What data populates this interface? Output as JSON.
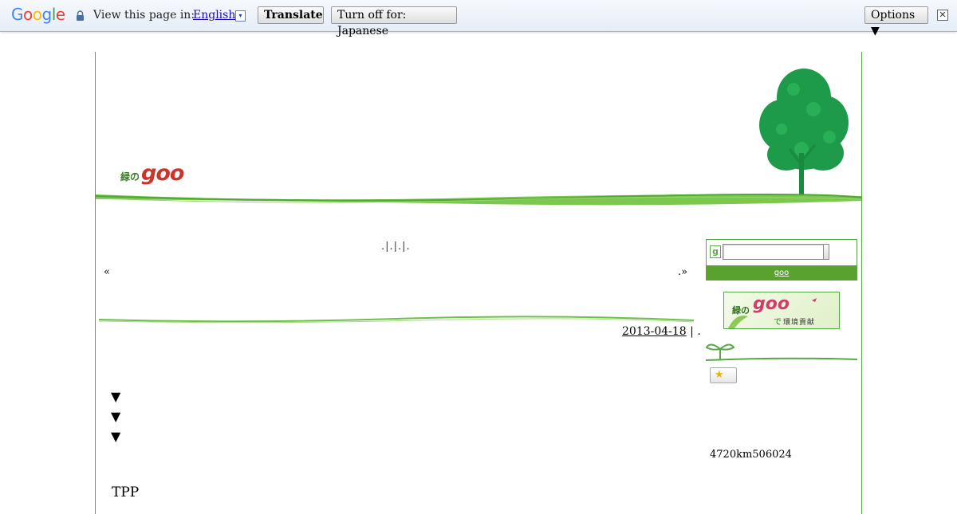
{
  "translate_bar": {
    "logo": "Google",
    "prompt": "View this page in:",
    "language": "English",
    "language_arrow": "▾",
    "translate_label": "Translate",
    "turn_off_label": "Turn off for: Japanese",
    "options_label": "Options ▼",
    "close_glyph": "✕"
  },
  "header": {
    "logo_kanji": "緑の",
    "logo_goo": "goo"
  },
  "main": {
    "title_marks": ".|.|.|.",
    "nav_prev_arrow": "«",
    "nav_prev_link": "  ",
    "nav_next": ".»",
    "post_date": "2013-04-18",
    "post_meta": " | .",
    "triangles": [
      "▼",
      "▼",
      "▼"
    ],
    "body_text": "TPP"
  },
  "sidebar": {
    "search_icon_letter": "g",
    "search_value": "",
    "search_link": "goo    ",
    "banner": {
      "kanji": "緑の",
      "goo": "goo",
      "de": "で",
      "subtitle": "環境貢献"
    },
    "star_glyph": "★",
    "counter_text": "4720km506024"
  },
  "colors": {
    "accent_green": "#58a848",
    "bar_green": "#5aa22f",
    "logo_red": "#c8362c"
  }
}
